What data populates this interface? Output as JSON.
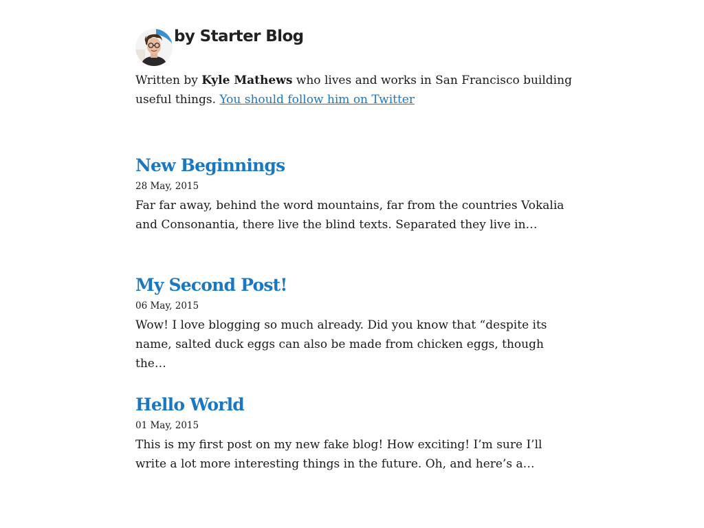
{
  "header": {
    "title": "by Starter Blog"
  },
  "bio": {
    "prefix": "Written by ",
    "author": "Kyle Mathews",
    "middle": " who lives and works in San Francisco building useful things. ",
    "link": "You should follow him on Twitter"
  },
  "posts": [
    {
      "title": "New Beginnings",
      "date": "28 May, 2015",
      "excerpt": "Far far away, behind the word mountains, far from the countries Vokalia and Consonantia, there live the blind texts. Separated they live in…"
    },
    {
      "title": "My Second Post!",
      "date": "06 May, 2015",
      "excerpt": "Wow! I love blogging so much already. Did you know that “despite its name, salted duck eggs can also be made from chicken eggs, though the…"
    },
    {
      "title": "Hello World",
      "date": "01 May, 2015",
      "excerpt": "This is my first post on my new fake blog! How exciting! I’m sure I’ll write a lot more interesting things in the future. Oh, and here’s a…"
    }
  ],
  "colors": {
    "accent": "#1a78c2",
    "text": "#1a1a1a",
    "title": "#222222"
  }
}
